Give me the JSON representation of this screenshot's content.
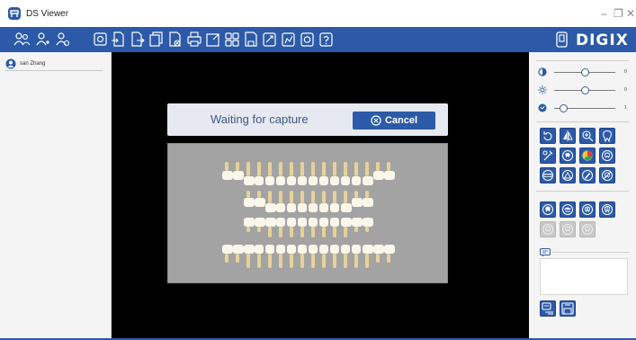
{
  "window": {
    "title": "DS Viewer",
    "app_icon": "ds-viewer-logo-icon",
    "controls": {
      "minimize": "–",
      "restore": "❐",
      "close": "✕"
    }
  },
  "toolbar": {
    "left_icons": [
      "new-patient-icon",
      "add-patient-icon",
      "edit-patient-icon"
    ],
    "acquire_icons": [
      "acquire-icon",
      "import-icon",
      "export-icon",
      "copy-image-icon",
      "delete-image-icon",
      "print-icon",
      "fullscreen-icon",
      "layout-grid-icon",
      "save-icon",
      "measure-icon",
      "annotate-icon",
      "settings-icon",
      "help-icon"
    ],
    "brand": "DIGIX"
  },
  "patient": {
    "name": "san Zhang"
  },
  "capture": {
    "status": "Waiting for capture",
    "cancel_label": "Cancel"
  },
  "adjustments": {
    "brightness_value": "0",
    "contrast_value": "0",
    "gamma_value": "1",
    "brightness_level": 0.5,
    "contrast_level": 0.5,
    "gamma_level": 0.15
  },
  "tools": {
    "image_tools": [
      "rotate-icon",
      "flip-icon",
      "zoom-icon",
      "tooth-icon",
      "sharpen-icon",
      "tooth-filter-icon",
      "color-icon",
      "tooth-outline-icon",
      "ruler-icon",
      "angle-icon",
      "draw-icon",
      "reset-icon"
    ],
    "tooth_tools": [
      "tooth-front-icon",
      "tooth-side-icon",
      "tooth-top-icon",
      "tooth-canal-icon"
    ],
    "tooth_tools_disabled": [
      "tooth-disabled-icon",
      "tooth-disabled-icon",
      "tooth-disabled-icon"
    ]
  },
  "notes": {
    "icon": "note-icon",
    "text": ""
  },
  "bottom_buttons": [
    "report-icon",
    "save-notes-icon"
  ],
  "colors": {
    "accent": "#2c5aa8",
    "viewer_bg": "#000000",
    "panel_bg": "#f4f4f4",
    "teeth_panel": "#a3a3a3"
  }
}
